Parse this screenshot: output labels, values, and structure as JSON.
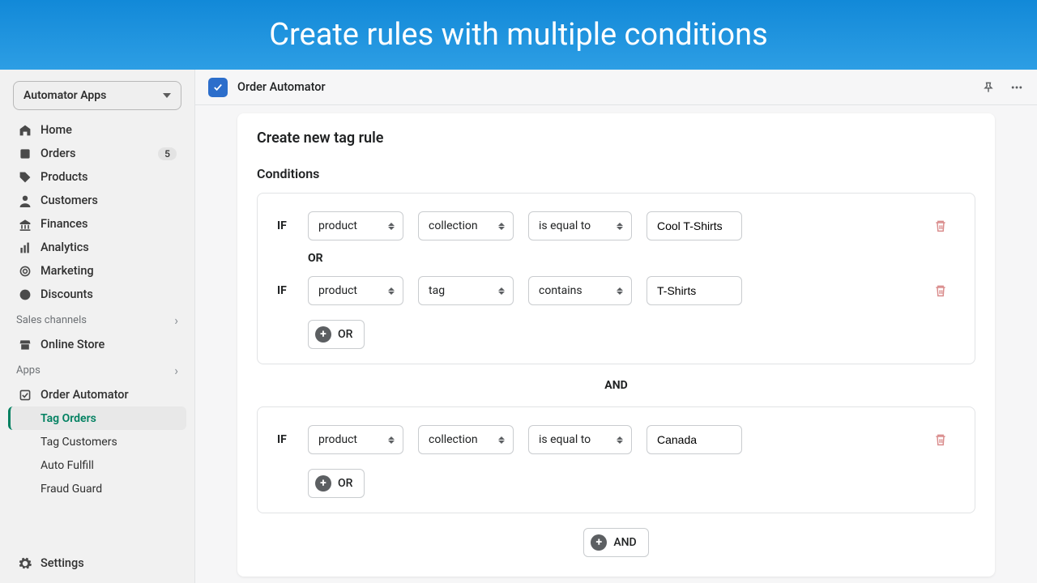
{
  "banner": {
    "title": "Create rules with multiple conditions"
  },
  "sidebar": {
    "app_selector": "Automator Apps",
    "nav": [
      {
        "label": "Home"
      },
      {
        "label": "Orders",
        "badge": "5"
      },
      {
        "label": "Products"
      },
      {
        "label": "Customers"
      },
      {
        "label": "Finances"
      },
      {
        "label": "Analytics"
      },
      {
        "label": "Marketing"
      },
      {
        "label": "Discounts"
      }
    ],
    "sales_channels_label": "Sales channels",
    "online_store": "Online Store",
    "apps_label": "Apps",
    "order_automator": "Order Automator",
    "sub": [
      {
        "label": "Tag Orders",
        "active": true
      },
      {
        "label": "Tag Customers"
      },
      {
        "label": "Auto Fulfill"
      },
      {
        "label": "Fraud Guard"
      }
    ],
    "settings": "Settings"
  },
  "topbar": {
    "title": "Order Automator"
  },
  "card": {
    "title": "Create new tag rule",
    "conditions_label": "Conditions",
    "if_label": "IF",
    "or_label": "OR",
    "and_label": "AND",
    "groups": [
      {
        "rows": [
          {
            "field": "product",
            "attr": "collection",
            "op": "is equal to",
            "value": "Cool T-Shirts"
          },
          {
            "field": "product",
            "attr": "tag",
            "op": "contains",
            "value": "T-Shirts"
          }
        ]
      },
      {
        "rows": [
          {
            "field": "product",
            "attr": "collection",
            "op": "is equal to",
            "value": "Canada"
          }
        ]
      }
    ]
  }
}
